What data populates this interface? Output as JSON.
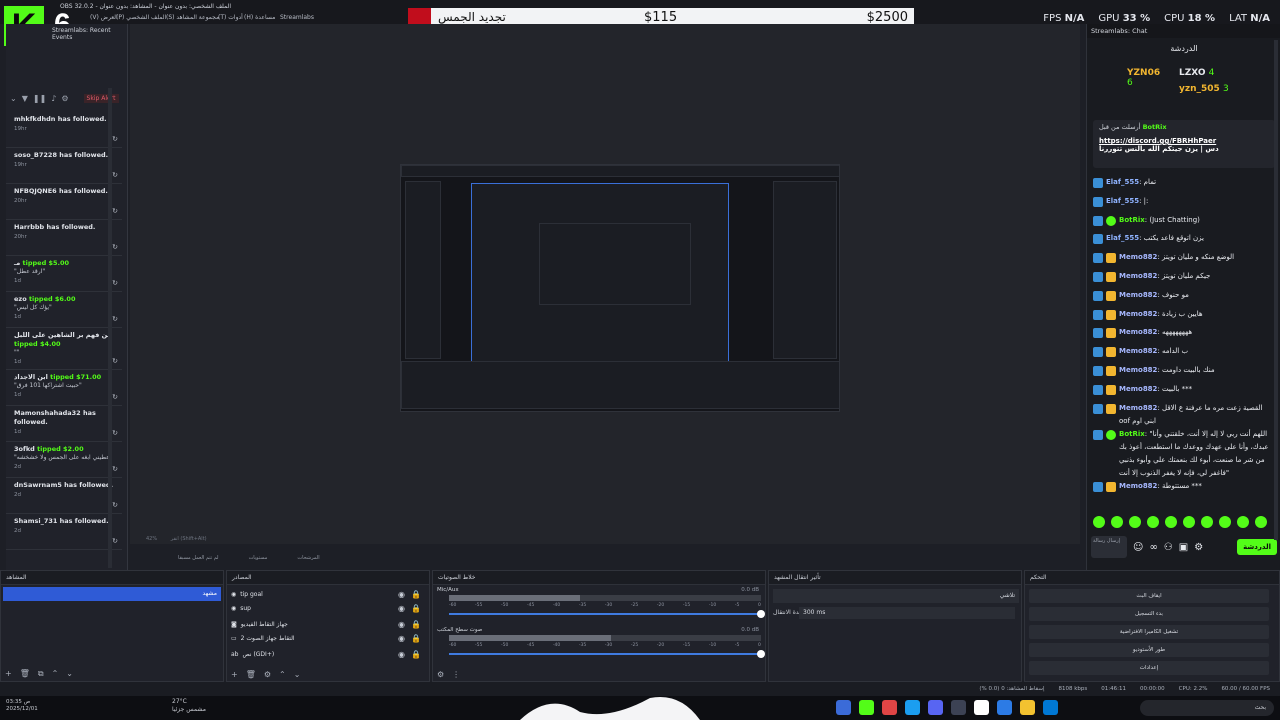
{
  "title": "OBS 32.0.2 - الملف الشخصي: بدون عنوان - المشاهد: بدون عنوان",
  "menu": [
    "Streamlabs",
    "(H) مساعدة",
    "(T) أدوات",
    "(S) مجموعة المشاهد",
    "(P) الملف الشخصي",
    "(V) العرض",
    "المفضلات"
  ],
  "logo": {
    "letter": "K",
    "number": "6"
  },
  "goal": {
    "label": "تجديد الجمس",
    "current": "$115",
    "target": "$2500",
    "progress_fraction": 0.046
  },
  "stats": [
    {
      "label": "FPS",
      "value": "N/A"
    },
    {
      "label": "GPU",
      "value": "33 %"
    },
    {
      "label": "CPU",
      "value": "18 %"
    },
    {
      "label": "LAT",
      "value": "N/A"
    }
  ],
  "events": {
    "header": "Streamlabs: Recent Events",
    "skip": "Skip Alert",
    "items": [
      {
        "who": "mhkfkdhdn",
        "action": "has followed.",
        "msg": "",
        "time": "19hr"
      },
      {
        "who": "soso_B7228",
        "action": "has followed.",
        "msg": "",
        "time": "19hr"
      },
      {
        "who": "NFBQJQNE6",
        "action": "has followed.",
        "msg": "",
        "time": "20hr"
      },
      {
        "who": "Harrbbb",
        "action": "has followed.",
        "msg": "",
        "time": "20hr"
      },
      {
        "who": "مـ",
        "action": "tipped $5.00",
        "msg": "\"ارقد عطل\"",
        "time": "1d"
      },
      {
        "who": "ezo",
        "action": "tipped $6.00",
        "msg": "\"يؤك كل ليس\"",
        "time": "1d"
      },
      {
        "who": "من فهم بر الشاهين على اللبل",
        "action": "tipped $4.00",
        "msg": "\"\"",
        "time": "1d"
      },
      {
        "who": "ابن الاجداد",
        "action": "tipped $71.00",
        "msg": "\"حبيت اشتراكها 101 فرق\"",
        "time": "1d"
      },
      {
        "who": "Mamonshahada32",
        "action": "has followed.",
        "msg": "",
        "time": "1d"
      },
      {
        "who": "3ofkd",
        "action": "tipped $2.00",
        "msg": "\"عطيني ابغه على الجمس ولا خشخشه\"",
        "time": "2d"
      },
      {
        "who": "dnSawrnam5",
        "action": "has followed.",
        "msg": "",
        "time": "2d"
      },
      {
        "who": "Shamsi_731",
        "action": "has followed.",
        "msg": "",
        "time": "2d"
      }
    ]
  },
  "preview": {
    "zoom": "42%",
    "status": "انقر (Shift+Alt)",
    "buttons": [
      "لم تتم العمل مسبقا",
      "مستويات",
      "المرشحات"
    ]
  },
  "chat": {
    "header": "Streamlabs: Chat",
    "tab": "الدردشة",
    "leaders": [
      {
        "name": "YZN06",
        "count": "6"
      },
      {
        "name": "LZXO",
        "count": "4"
      },
      {
        "name": "yzn_505",
        "count": "3"
      }
    ],
    "pinned": {
      "by": "أرسلت من قبل",
      "bot": "BotRix",
      "link": "https://discord.gg/FBRHhPaer",
      "text": "دس | يزن جيتكم الله بالنس تتوررنا"
    },
    "messages": [
      {
        "user": "Elaf_555",
        "text": "تمام",
        "kind": "sub"
      },
      {
        "user": "Elaf_555",
        "text": "|:",
        "kind": "sub"
      },
      {
        "user": "BotRix",
        "text": "(Just Chatting)",
        "kind": "bot"
      },
      {
        "user": "Elaf_555",
        "text": "يزن اتوقع فاعد يكتب",
        "kind": "sub"
      },
      {
        "user": "Memo882",
        "text": "الوضع منكه و مليان تويتز",
        "kind": "memo"
      },
      {
        "user": "Memo882",
        "text": "جيكم مليان تويتز",
        "kind": "memo"
      },
      {
        "user": "Memo882",
        "text": "مو حنوف",
        "kind": "memo"
      },
      {
        "user": "Memo882",
        "text": "هايين ب زيادة",
        "kind": "memo"
      },
      {
        "user": "Memo882",
        "text": "ههههههههه",
        "kind": "memo"
      },
      {
        "user": "Memo882",
        "text": "ب الدامه",
        "kind": "memo"
      },
      {
        "user": "Memo882",
        "text": "منك بالبيت داومت",
        "kind": "memo"
      },
      {
        "user": "Memo882",
        "text": "بالبيت ***",
        "kind": "memo"
      },
      {
        "user": "Memo882",
        "text": "القصية زعت مره ما عرفنة ع الاقل oof ابني اوم",
        "kind": "memo"
      },
      {
        "user": "BotRix",
        "text": "\"اللهم أنت ربي لا إله إلا أنت، خلقتني وأنا عبدك، وأنا على عهدك ووعدك ما استطعت، أعوذ بك من شر ما صنعت، أبوء لك بنعمتك علي وأبوء بذنبي فاغفر لي، فإنه لا يغفر الذنوب إلا أنت\"",
        "kind": "bot"
      },
      {
        "user": "Memo882",
        "text": "مستتوطة ***",
        "kind": "memo"
      }
    ],
    "input_placeholder": "إرسال رسالة",
    "send": "الدردشة"
  },
  "docks": {
    "scenes": {
      "title": "المشاهد",
      "selected": "مشهد"
    },
    "sources": {
      "title": "المصادر",
      "items": [
        "tip goal",
        "sup",
        "جهاز التقاط الفيديو",
        "التقاط جهاز الصوت 2",
        "نص (GDI+)"
      ]
    },
    "mixer": {
      "title": "خلاط الصوتيات",
      "channels": [
        {
          "name": "Mic/Aux",
          "db": "0.0 dB",
          "level": 0.42
        },
        {
          "name": "صوت سطح المكتب",
          "db": "0.0 dB",
          "level": 0.52
        }
      ],
      "scale": [
        "-60",
        "-55",
        "-50",
        "-45",
        "-40",
        "-35",
        "-30",
        "-25",
        "-20",
        "-15",
        "-10",
        "-5",
        "0"
      ]
    },
    "transitions": {
      "title": "تأثير انتقال المشهد",
      "selected": "تلاشي",
      "duration_label": "مدة الانتقال",
      "duration": "300 ms"
    },
    "controls": {
      "title": "التحكم",
      "buttons": [
        "ايقاف البث",
        "بدء التسجيل",
        "تشغيل الكاميرا الافتراضية",
        "طور الأستوديو",
        "إعدادات"
      ]
    }
  },
  "obsstatus": [
    "إسقاط المشاهد: 0 (0.0 %)",
    "8108 kbps",
    "01:46:11",
    "00:00:00",
    "CPU: 2.2%",
    "60.00 / 60.00 FPS"
  ],
  "taskbar": {
    "clock": "03:35 ص",
    "date": "2025/12/01",
    "temp": "27°C",
    "weather": "مشمس جزئيا",
    "search": "بحث"
  },
  "colors": {
    "kick_green": "#53fc18",
    "goal_red": "#c10d1c",
    "selection_blue": "#2f5bd6"
  }
}
